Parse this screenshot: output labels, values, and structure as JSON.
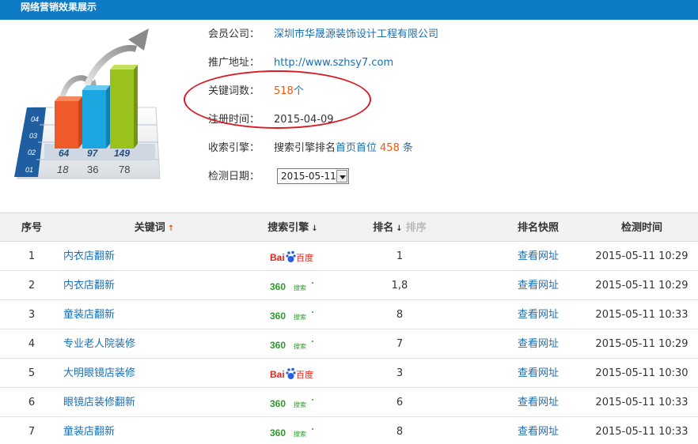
{
  "header": {
    "title": "网络营销效果展示"
  },
  "chart_icon": {
    "bars": [
      {
        "value": "64",
        "color": "#ef5a2a"
      },
      {
        "value": "97",
        "color": "#1aa7e0"
      },
      {
        "value": "149",
        "color": "#9ac21c"
      }
    ],
    "below_values": [
      "18",
      "36",
      "78"
    ],
    "row_labels": [
      "04",
      "03",
      "02",
      "01"
    ]
  },
  "info": {
    "company_label": "会员公司：",
    "company_value": "深圳市华晟源装饰设计工程有限公司",
    "site_label": "推广地址：",
    "site_value": "http://www.szhsy7.com",
    "keywords_label": "关键词数：",
    "keywords_count": "518",
    "keywords_unit": "个",
    "reg_label": "注册时间：",
    "reg_value": "2015-04-09",
    "engine_label": "收索引擎：",
    "engine_prefix": "搜索引擎排名",
    "engine_link": "首页首位",
    "engine_count": "458",
    "engine_unit": "条",
    "check_label": "检测日期：",
    "check_value": "2015-05-11"
  },
  "table": {
    "headers": {
      "idx": "序号",
      "keyword": "关键词",
      "keyword_arrow": "↑",
      "engine": "搜索引擎",
      "engine_arrow": "↓",
      "rank": "排名",
      "rank_arrow": "↓",
      "rank_sort": "排序",
      "snapshot": "排名快照",
      "time": "检测时间"
    },
    "rows": [
      {
        "idx": "1",
        "keyword": "内衣店翻新",
        "engine": "baidu",
        "rank": "1",
        "snapshot": "查看网址",
        "time": "2015-05-11 10:29"
      },
      {
        "idx": "2",
        "keyword": "内衣店翻新",
        "engine": "360",
        "rank": "1,8",
        "snapshot": "查看网址",
        "time": "2015-05-11 10:29"
      },
      {
        "idx": "3",
        "keyword": "童装店翻新",
        "engine": "360",
        "rank": "8",
        "snapshot": "查看网址",
        "time": "2015-05-11 10:33"
      },
      {
        "idx": "4",
        "keyword": "专业老人院装修",
        "engine": "360",
        "rank": "7",
        "snapshot": "查看网址",
        "time": "2015-05-11 10:29"
      },
      {
        "idx": "5",
        "keyword": "大明眼镜店装修",
        "engine": "baidu",
        "rank": "3",
        "snapshot": "查看网址",
        "time": "2015-05-11 10:30"
      },
      {
        "idx": "6",
        "keyword": "眼镜店装修翻新",
        "engine": "360",
        "rank": "6",
        "snapshot": "查看网址",
        "time": "2015-05-11 10:33"
      },
      {
        "idx": "7",
        "keyword": "童装店翻新",
        "engine": "360",
        "rank": "8",
        "snapshot": "查看网址",
        "time": "2015-05-11 10:33"
      }
    ]
  },
  "engine_logos": {
    "baidu": {
      "text_left": "Bai",
      "text_right": "百度",
      "color": "#e1251b",
      "paw_color": "#2b5fd9"
    },
    "360": {
      "text": "360",
      "sub": "搜索",
      "color": "#2d9b2d"
    }
  },
  "colors": {
    "accent": "#0e7bc7",
    "link": "#1a6fb5",
    "highlight": "#f05a14",
    "annotation": "#d81b22"
  }
}
